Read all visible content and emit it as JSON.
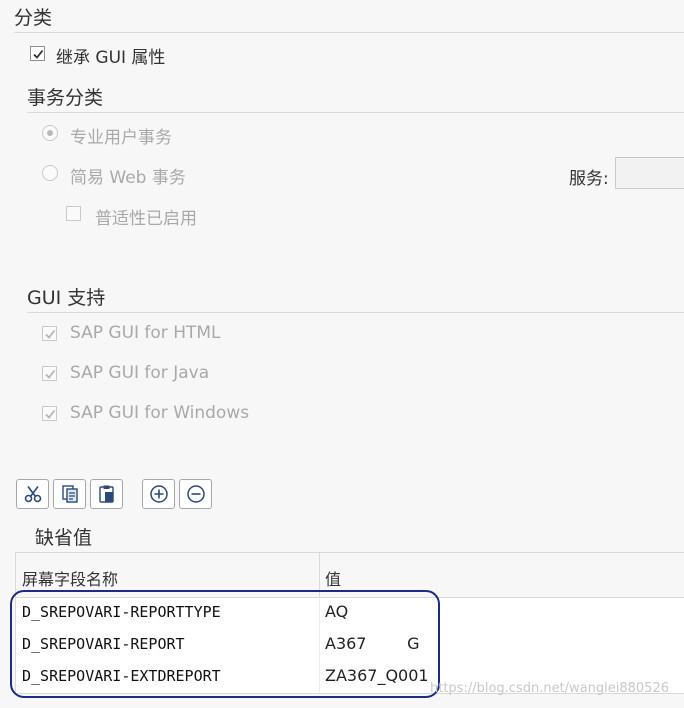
{
  "category": {
    "title": "分类",
    "inherit_gui_attr": {
      "label": "继承 GUI 属性",
      "checked": true
    }
  },
  "transaction_category": {
    "title": "事务分类",
    "options": [
      {
        "label": "专业用户事务",
        "selected": true
      },
      {
        "label": "简易 Web 事务",
        "selected": false
      }
    ],
    "pervasive_enabled": {
      "label": "普适性已启用",
      "checked": false
    },
    "service_label": "服务:"
  },
  "gui_support": {
    "title": "GUI 支持",
    "items": [
      {
        "label": "SAP GUI for HTML",
        "checked": true
      },
      {
        "label": "SAP GUI for Java",
        "checked": true
      },
      {
        "label": "SAP GUI for Windows",
        "checked": true
      }
    ]
  },
  "toolbar": {
    "buttons": [
      "scissors-icon",
      "copy-icon",
      "paste-icon",
      "plus-circle-icon",
      "minus-circle-icon"
    ]
  },
  "default_values": {
    "title": "缺省值",
    "columns": [
      "屏幕字段名称",
      "值"
    ],
    "rows": [
      {
        "field": "D_SREPOVARI-REPORTTYPE",
        "value": "AQ"
      },
      {
        "field": "D_SREPOVARI-REPORT",
        "value": "A367        G"
      },
      {
        "field": "D_SREPOVARI-EXTDREPORT",
        "value": "ZA367_Q001"
      }
    ]
  },
  "watermark": "https://blog.csdn.net/wanglei880526",
  "colors": {
    "annotation_ring": "#1d2a88",
    "disabled_text": "#a9a9a9"
  }
}
